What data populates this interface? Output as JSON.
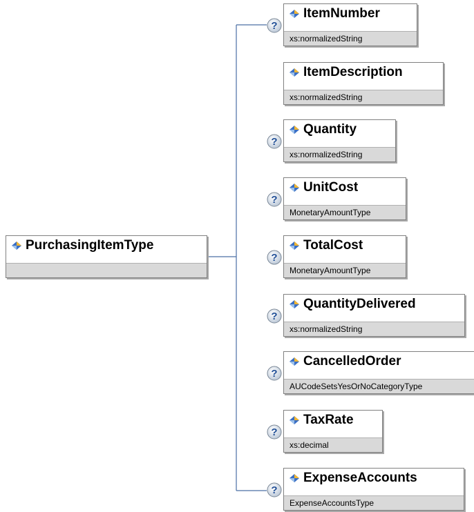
{
  "root": {
    "name": "PurchasingItemType"
  },
  "children": [
    {
      "name": "ItemNumber",
      "type": "xs:normalizedString",
      "optional": true
    },
    {
      "name": "ItemDescription",
      "type": "xs:normalizedString",
      "optional": false
    },
    {
      "name": "Quantity",
      "type": "xs:normalizedString",
      "optional": true
    },
    {
      "name": "UnitCost",
      "type": "MonetaryAmountType",
      "optional": true
    },
    {
      "name": "TotalCost",
      "type": "MonetaryAmountType",
      "optional": true
    },
    {
      "name": "QuantityDelivered",
      "type": "xs:normalizedString",
      "optional": true
    },
    {
      "name": "CancelledOrder",
      "type": "AUCodeSetsYesOrNoCategoryType",
      "optional": true
    },
    {
      "name": "TaxRate",
      "type": "xs:decimal",
      "optional": true
    },
    {
      "name": "ExpenseAccounts",
      "type": "ExpenseAccountsType",
      "optional": true
    }
  ],
  "icons": {
    "element": "element-diamond-icon",
    "optional": "question-mark-icon"
  },
  "colors": {
    "connector": "#4a6fa5",
    "type_band": "#d9d9d9",
    "border": "#808080"
  }
}
